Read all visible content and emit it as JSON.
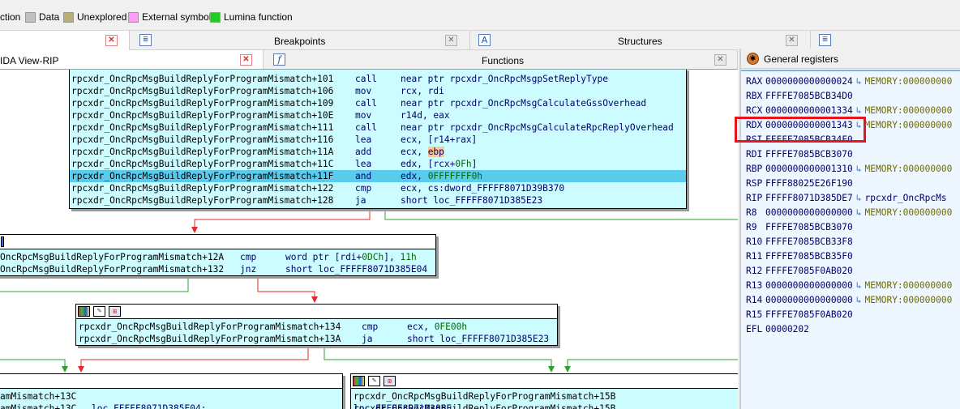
{
  "legend": [
    {
      "label": "ction",
      "color": ""
    },
    {
      "label": "Data",
      "color": "#c0c0c0"
    },
    {
      "label": "Unexplored",
      "color": "#b9ae78"
    },
    {
      "label": "External symbol",
      "color": "#ff9cf5"
    },
    {
      "label": "Lumina function",
      "color": "#22cc22"
    }
  ],
  "tabs_row1": {
    "breakpoints": "Breakpoints",
    "structures": "Structures"
  },
  "tabs_row2": {
    "ida_view": "IDA View-RIP",
    "functions": "Functions"
  },
  "registers_panel": {
    "title": "General registers",
    "rows": [
      {
        "name": "RAX",
        "value": "0000000000000024",
        "ref": "MEMORY:000000000"
      },
      {
        "name": "RBX",
        "value": "FFFFE7085BCB34D0",
        "ref": ""
      },
      {
        "name": "RCX",
        "value": "0000000000001334",
        "ref": "MEMORY:000000000"
      },
      {
        "name": "RDX",
        "value": "0000000000001343",
        "ref": "MEMORY:000000000"
      },
      {
        "name": "RSI",
        "value": "FFFFE7085BCB34F0",
        "ref": ""
      },
      {
        "name": "RDI",
        "value": "FFFFE7085BCB3070",
        "ref": ""
      },
      {
        "name": "RBP",
        "value": "0000000000001310",
        "ref": "MEMORY:000000000"
      },
      {
        "name": "RSP",
        "value": "FFFF88025E26F190",
        "ref": ""
      },
      {
        "name": "RIP",
        "value": "FFFFF8071D385DE7",
        "ref": "rpcxdr_OncRpcMs"
      },
      {
        "name": "R8",
        "value": "0000000000000000",
        "ref": "MEMORY:000000000"
      },
      {
        "name": "R9",
        "value": "FFFFE7085BCB3070",
        "ref": ""
      },
      {
        "name": "R10",
        "value": "FFFFE7085BCB33F8",
        "ref": ""
      },
      {
        "name": "R11",
        "value": "FFFFE7085BCB35F0",
        "ref": ""
      },
      {
        "name": "R12",
        "value": "FFFFE7085F0AB020",
        "ref": ""
      },
      {
        "name": "R13",
        "value": "0000000000000000",
        "ref": "MEMORY:000000000"
      },
      {
        "name": "R14",
        "value": "0000000000000000",
        "ref": "MEMORY:000000000"
      },
      {
        "name": "R15",
        "value": "FFFFE7085F0AB020",
        "ref": ""
      },
      {
        "name": "EFL",
        "value": "00000202",
        "ref": ""
      }
    ]
  },
  "node_main": [
    {
      "addr": "rpcxdr_OncRpcMsgBuildReplyForProgramMismatch+101",
      "mn": "call",
      "op": "near ptr rpcxdr_OncRpcMsgpSetReplyType"
    },
    {
      "addr": "rpcxdr_OncRpcMsgBuildReplyForProgramMismatch+106",
      "mn": "mov",
      "op": "rcx, rdi"
    },
    {
      "addr": "rpcxdr_OncRpcMsgBuildReplyForProgramMismatch+109",
      "mn": "call",
      "op": "near ptr rpcxdr_OncRpcMsgCalculateGssOverhead"
    },
    {
      "addr": "rpcxdr_OncRpcMsgBuildReplyForProgramMismatch+10E",
      "mn": "mov",
      "op": "r14d, eax"
    },
    {
      "addr": "rpcxdr_OncRpcMsgBuildReplyForProgramMismatch+111",
      "mn": "call",
      "op": "near ptr rpcxdr_OncRpcMsgCalculateRpcReplyOverhead"
    },
    {
      "addr": "rpcxdr_OncRpcMsgBuildReplyForProgramMismatch+116",
      "mn": "lea",
      "op": "ecx, [r14+rax]"
    },
    {
      "addr": "rpcxdr_OncRpcMsgBuildReplyForProgramMismatch+11A",
      "mn": "add",
      "op": "ecx, ",
      "op_hl": "ebp"
    },
    {
      "addr": "rpcxdr_OncRpcMsgBuildReplyForProgramMismatch+11C",
      "mn": "lea",
      "op": "edx, [rcx+",
      "op_num": "0Fh",
      "op_tail": "]"
    },
    {
      "addr": "rpcxdr_OncRpcMsgBuildReplyForProgramMismatch+11F",
      "mn": "and",
      "op": "edx, ",
      "op_num": "0FFFFFFF0h",
      "selected": true
    },
    {
      "addr": "rpcxdr_OncRpcMsgBuildReplyForProgramMismatch+122",
      "mn": "cmp",
      "op": "ecx, cs:dword_FFFFF8071D39B370"
    },
    {
      "addr": "rpcxdr_OncRpcMsgBuildReplyForProgramMismatch+128",
      "mn": "ja",
      "op": "short loc_FFFFF8071D385E23"
    }
  ],
  "node_b": [
    {
      "addr": "OncRpcMsgBuildReplyForProgramMismatch+12A",
      "mn": "cmp",
      "op": "word ptr [rdi+",
      "op_num": "0DCh",
      "op_mid": "], ",
      "op_num2": "11h"
    },
    {
      "addr": "OncRpcMsgBuildReplyForProgramMismatch+132",
      "mn": "jnz",
      "op": "short loc_FFFFF8071D385E04"
    }
  ],
  "node_c": [
    {
      "addr": "rpcxdr_OncRpcMsgBuildReplyForProgramMismatch+134",
      "mn": "cmp",
      "op": "ecx, ",
      "op_num": "0FE00h"
    },
    {
      "addr": "rpcxdr_OncRpcMsgBuildReplyForProgramMismatch+13A",
      "mn": "ja",
      "op": "short loc_FFFFF8071D385E23"
    }
  ],
  "node_d": [
    {
      "addr": "amMismatch+13C",
      "mn": "",
      "op": ""
    },
    {
      "addr": "amMismatch+13C",
      "mn": "",
      "op": "loc_FFFFF8071D385E04:"
    }
  ],
  "node_e": [
    {
      "addr": "rpcxdr_OncRpcMsgBuildReplyForProgramMismatch+15B",
      "mn": "",
      "op": ""
    },
    {
      "addr": "rpcxdr_OncRpcMsgBuildReplyForProgramMismatch+15B",
      "mn": "",
      "op": "loc_FFFFF8071D385E"
    }
  ]
}
